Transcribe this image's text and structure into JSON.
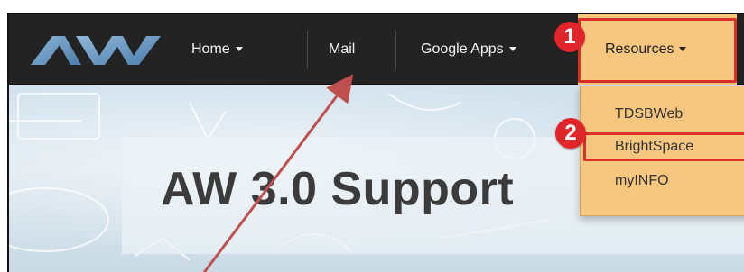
{
  "navbar": {
    "logo_text": "AW",
    "items": [
      {
        "label": "Home",
        "has_caret": true
      },
      {
        "label": "Mail",
        "has_caret": false
      },
      {
        "label": "Google Apps",
        "has_caret": true
      },
      {
        "label": "Resources",
        "has_caret": true
      }
    ]
  },
  "dropdown": {
    "items": [
      "TDSBWeb",
      "BrightSpace",
      "myINFO"
    ]
  },
  "hero": {
    "title": "AW 3.0 Support"
  },
  "annotations": {
    "step1": "1",
    "step2": "2"
  },
  "colors": {
    "navbar_bg": "#232323",
    "highlight_bg": "#f7c67f",
    "annotation_red": "#d9312a",
    "arrow_color": "#c0504d"
  }
}
